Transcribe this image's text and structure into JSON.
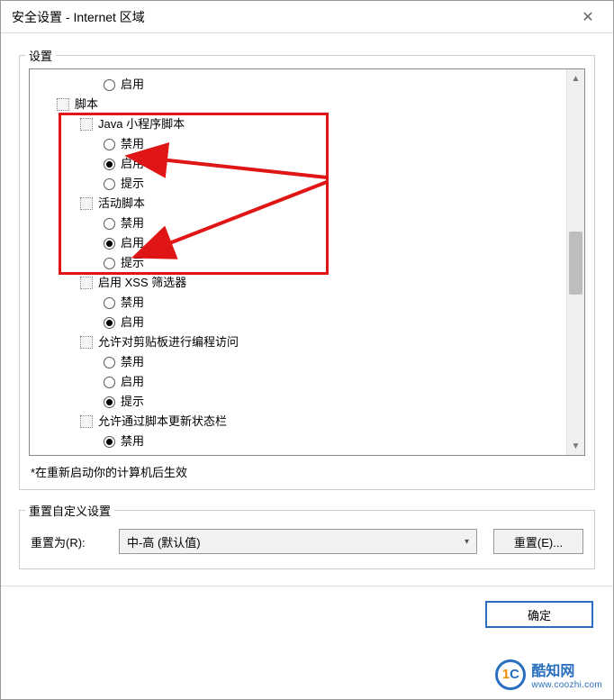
{
  "window": {
    "title": "安全设置 - Internet 区域"
  },
  "settings": {
    "legend": "设置",
    "opt_disable": "禁用",
    "opt_enable": "启用",
    "opt_prompt": "提示",
    "top_option": "启用",
    "cat_scripts": "脚本",
    "cat_java_applet": "Java 小程序脚本",
    "cat_active_script": "活动脚本",
    "cat_xss_filter": "启用 XSS 筛选器",
    "cat_clipboard": "允许对剪贴板进行编程访问",
    "cat_statusbar": "允许通过脚本更新状态栏",
    "note": "*在重新启动你的计算机后生效"
  },
  "reset": {
    "legend": "重置自定义设置",
    "label": "重置为(R):",
    "selected": "中-高 (默认值)",
    "button": "重置(E)..."
  },
  "footer": {
    "ok": "确定"
  },
  "watermark": {
    "name": "酷知网",
    "url": "www.coozhi.com",
    "logo1": "1",
    "logo2": "C"
  }
}
